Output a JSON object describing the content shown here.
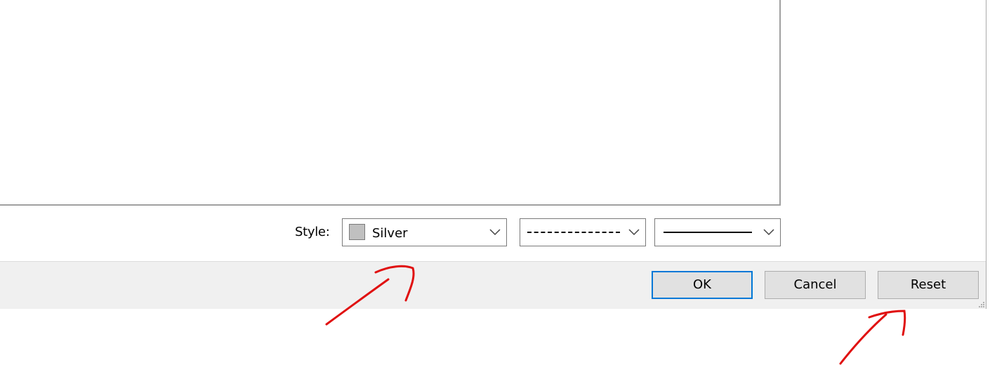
{
  "style_row": {
    "label": "Style:",
    "color_combo": {
      "value": "Silver",
      "swatch_color": "#c0c0c0"
    },
    "dash_combo": {
      "value_style": "dashed"
    },
    "width_combo": {
      "value_style": "solid"
    }
  },
  "buttons": {
    "ok_label": "OK",
    "cancel_label": "Cancel",
    "reset_label": "Reset"
  },
  "colors": {
    "focus_border": "#0078d7",
    "footer_bg": "#f0f0f0",
    "annotation_stroke": "#e01010"
  }
}
